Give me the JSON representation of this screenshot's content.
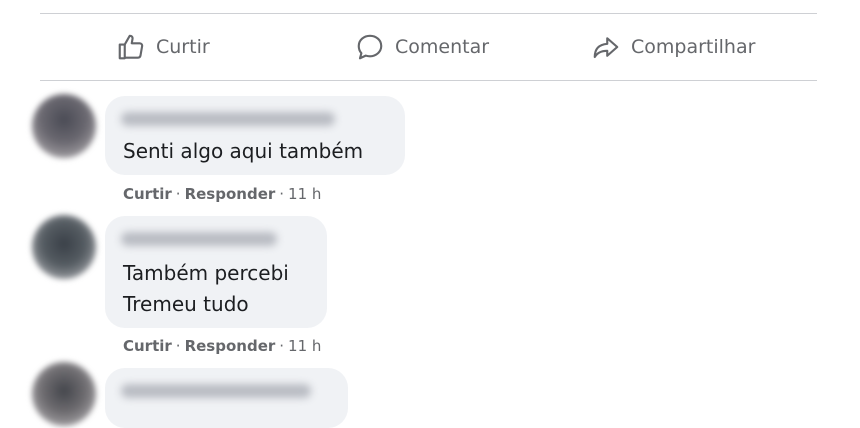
{
  "actions": {
    "like_label": "Curtir",
    "comment_label": "Comentar",
    "share_label": "Compartilhar"
  },
  "comments": [
    {
      "lines": [
        "Senti algo aqui também"
      ],
      "like_label": "Curtir",
      "reply_label": "Responder",
      "separator": "·",
      "time": "11 h"
    },
    {
      "lines": [
        "Também percebi",
        "Tremeu tudo"
      ],
      "like_label": "Curtir",
      "reply_label": "Responder",
      "separator": "·",
      "time": "11 h"
    },
    {
      "lines": []
    }
  ],
  "colors": {
    "icon_gray": "#65676b",
    "bubble_bg": "#f0f2f5",
    "divider": "#ced0d4"
  }
}
